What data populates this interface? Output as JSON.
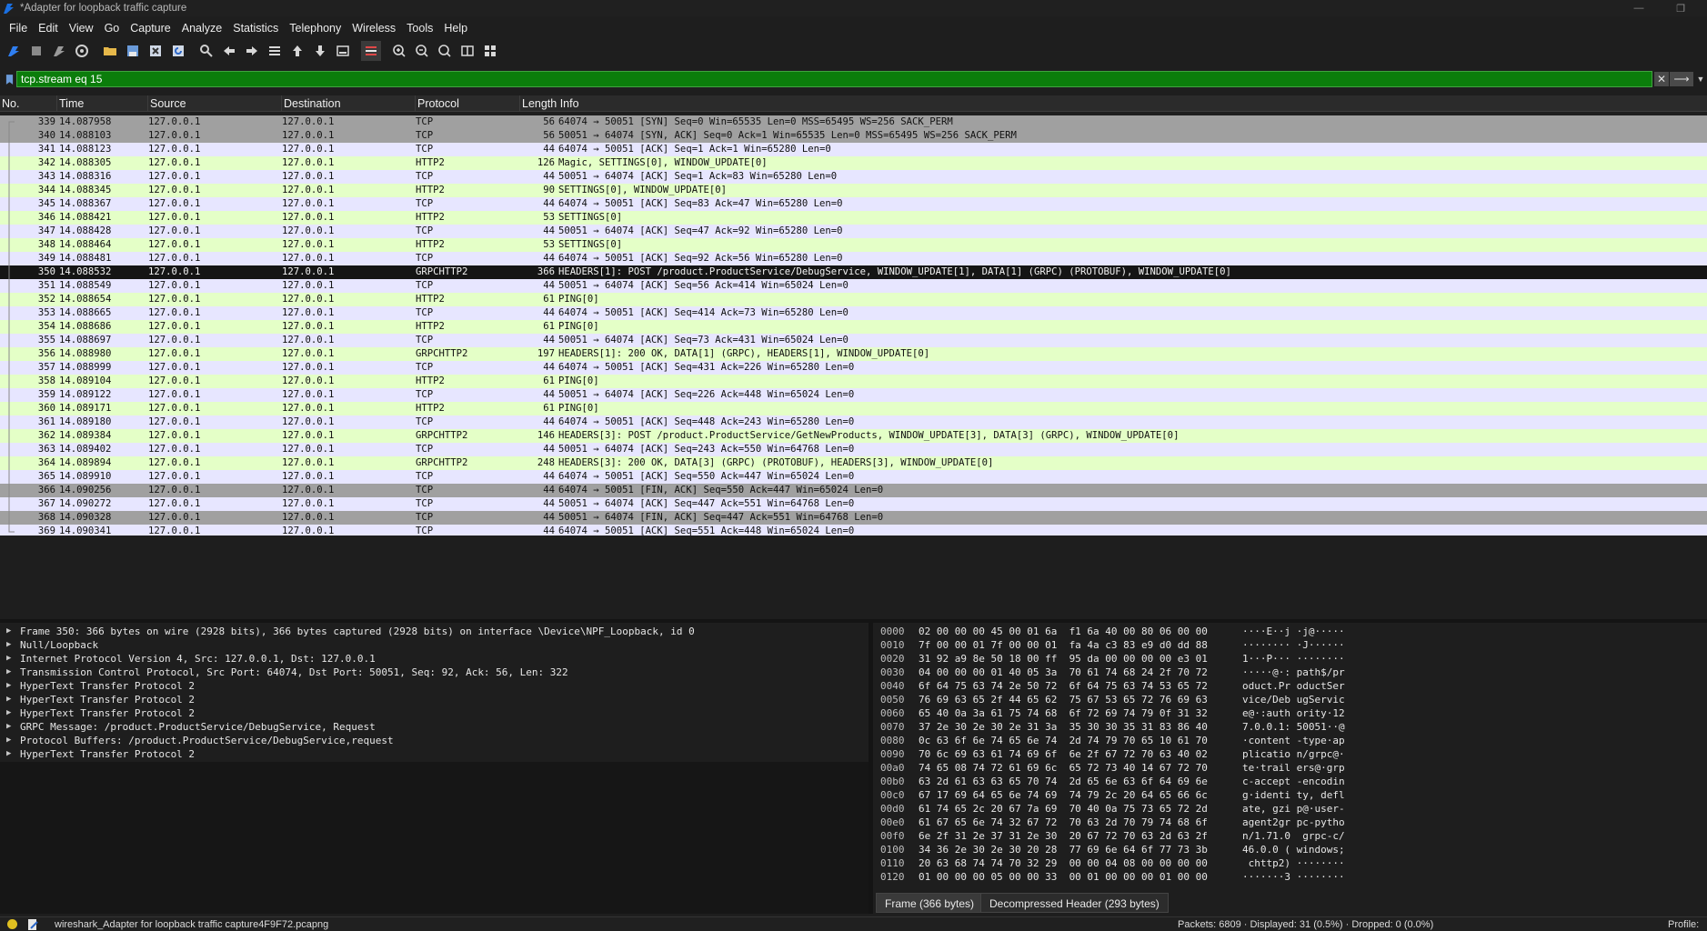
{
  "window": {
    "title": "*Adapter for loopback traffic capture",
    "minimize_glyph": "—",
    "maximize_glyph": "❐"
  },
  "menu": [
    "File",
    "Edit",
    "View",
    "Go",
    "Capture",
    "Analyze",
    "Statistics",
    "Telephony",
    "Wireless",
    "Tools",
    "Help"
  ],
  "toolbar_icons": [
    "shark-fin-start-icon",
    "stop-square-icon",
    "restart-fin-icon",
    "capture-options-icon",
    "open-folder-icon",
    "save-file-icon",
    "close-file-icon",
    "reload-icon",
    "find-packet-icon",
    "go-back-icon",
    "go-forward-icon",
    "go-to-packet-icon",
    "go-first-icon",
    "go-last-icon",
    "autoscroll-icon",
    "colorize-icon",
    "zoom-in-icon",
    "zoom-out-icon",
    "normal-size-icon",
    "resize-columns-icon",
    "expand-grid-icon"
  ],
  "filter": {
    "value": "tcp.stream eq 15",
    "clear_glyph": "✕",
    "apply_glyph": "⟶",
    "dropdown_glyph": "▼"
  },
  "columns": {
    "no": "No.",
    "time": "Time",
    "source": "Source",
    "destination": "Destination",
    "protocol": "Protocol",
    "length_info": "Length Info"
  },
  "packets": [
    {
      "no": "339",
      "time": "14.087958",
      "src": "127.0.0.1",
      "dst": "127.0.0.1",
      "proto": "TCP",
      "len": "56",
      "info": "64074 → 50051 [SYN] Seq=0 Win=65535 Len=0 MSS=65495 WS=256 SACK_PERM",
      "style": "fin"
    },
    {
      "no": "340",
      "time": "14.088103",
      "src": "127.0.0.1",
      "dst": "127.0.0.1",
      "proto": "TCP",
      "len": "56",
      "info": "50051 → 64074 [SYN, ACK] Seq=0 Ack=1 Win=65535 Len=0 MSS=65495 WS=256 SACK_PERM",
      "style": "fin"
    },
    {
      "no": "341",
      "time": "14.088123",
      "src": "127.0.0.1",
      "dst": "127.0.0.1",
      "proto": "TCP",
      "len": "44",
      "info": "64074 → 50051 [ACK] Seq=1 Ack=1 Win=65280 Len=0",
      "style": "tcp"
    },
    {
      "no": "342",
      "time": "14.088305",
      "src": "127.0.0.1",
      "dst": "127.0.0.1",
      "proto": "HTTP2",
      "len": "126",
      "info": "Magic, SETTINGS[0], WINDOW_UPDATE[0]",
      "style": "http2"
    },
    {
      "no": "343",
      "time": "14.088316",
      "src": "127.0.0.1",
      "dst": "127.0.0.1",
      "proto": "TCP",
      "len": "44",
      "info": "50051 → 64074 [ACK] Seq=1 Ack=83 Win=65280 Len=0",
      "style": "tcp"
    },
    {
      "no": "344",
      "time": "14.088345",
      "src": "127.0.0.1",
      "dst": "127.0.0.1",
      "proto": "HTTP2",
      "len": "90",
      "info": "SETTINGS[0], WINDOW_UPDATE[0]",
      "style": "http2"
    },
    {
      "no": "345",
      "time": "14.088367",
      "src": "127.0.0.1",
      "dst": "127.0.0.1",
      "proto": "TCP",
      "len": "44",
      "info": "64074 → 50051 [ACK] Seq=83 Ack=47 Win=65280 Len=0",
      "style": "tcp"
    },
    {
      "no": "346",
      "time": "14.088421",
      "src": "127.0.0.1",
      "dst": "127.0.0.1",
      "proto": "HTTP2",
      "len": "53",
      "info": "SETTINGS[0]",
      "style": "http2"
    },
    {
      "no": "347",
      "time": "14.088428",
      "src": "127.0.0.1",
      "dst": "127.0.0.1",
      "proto": "TCP",
      "len": "44",
      "info": "50051 → 64074 [ACK] Seq=47 Ack=92 Win=65280 Len=0",
      "style": "tcp"
    },
    {
      "no": "348",
      "time": "14.088464",
      "src": "127.0.0.1",
      "dst": "127.0.0.1",
      "proto": "HTTP2",
      "len": "53",
      "info": "SETTINGS[0]",
      "style": "http2"
    },
    {
      "no": "349",
      "time": "14.088481",
      "src": "127.0.0.1",
      "dst": "127.0.0.1",
      "proto": "TCP",
      "len": "44",
      "info": "64074 → 50051 [ACK] Seq=92 Ack=56 Win=65280 Len=0",
      "style": "tcp"
    },
    {
      "no": "350",
      "time": "14.088532",
      "src": "127.0.0.1",
      "dst": "127.0.0.1",
      "proto": "GRPCHTTP2",
      "len": "366",
      "info": "HEADERS[1]: POST /product.ProductService/DebugService, WINDOW_UPDATE[1], DATA[1] (GRPC) (PROTOBUF), WINDOW_UPDATE[0]",
      "style": "sel"
    },
    {
      "no": "351",
      "time": "14.088549",
      "src": "127.0.0.1",
      "dst": "127.0.0.1",
      "proto": "TCP",
      "len": "44",
      "info": "50051 → 64074 [ACK] Seq=56 Ack=414 Win=65024 Len=0",
      "style": "tcp"
    },
    {
      "no": "352",
      "time": "14.088654",
      "src": "127.0.0.1",
      "dst": "127.0.0.1",
      "proto": "HTTP2",
      "len": "61",
      "info": "PING[0]",
      "style": "http2"
    },
    {
      "no": "353",
      "time": "14.088665",
      "src": "127.0.0.1",
      "dst": "127.0.0.1",
      "proto": "TCP",
      "len": "44",
      "info": "64074 → 50051 [ACK] Seq=414 Ack=73 Win=65280 Len=0",
      "style": "tcp"
    },
    {
      "no": "354",
      "time": "14.088686",
      "src": "127.0.0.1",
      "dst": "127.0.0.1",
      "proto": "HTTP2",
      "len": "61",
      "info": "PING[0]",
      "style": "http2"
    },
    {
      "no": "355",
      "time": "14.088697",
      "src": "127.0.0.1",
      "dst": "127.0.0.1",
      "proto": "TCP",
      "len": "44",
      "info": "50051 → 64074 [ACK] Seq=73 Ack=431 Win=65024 Len=0",
      "style": "tcp"
    },
    {
      "no": "356",
      "time": "14.088980",
      "src": "127.0.0.1",
      "dst": "127.0.0.1",
      "proto": "GRPCHTTP2",
      "len": "197",
      "info": "HEADERS[1]: 200 OK, DATA[1] (GRPC), HEADERS[1], WINDOW_UPDATE[0]",
      "style": "http2"
    },
    {
      "no": "357",
      "time": "14.088999",
      "src": "127.0.0.1",
      "dst": "127.0.0.1",
      "proto": "TCP",
      "len": "44",
      "info": "64074 → 50051 [ACK] Seq=431 Ack=226 Win=65280 Len=0",
      "style": "tcp"
    },
    {
      "no": "358",
      "time": "14.089104",
      "src": "127.0.0.1",
      "dst": "127.0.0.1",
      "proto": "HTTP2",
      "len": "61",
      "info": "PING[0]",
      "style": "http2"
    },
    {
      "no": "359",
      "time": "14.089122",
      "src": "127.0.0.1",
      "dst": "127.0.0.1",
      "proto": "TCP",
      "len": "44",
      "info": "50051 → 64074 [ACK] Seq=226 Ack=448 Win=65024 Len=0",
      "style": "tcp"
    },
    {
      "no": "360",
      "time": "14.089171",
      "src": "127.0.0.1",
      "dst": "127.0.0.1",
      "proto": "HTTP2",
      "len": "61",
      "info": "PING[0]",
      "style": "http2"
    },
    {
      "no": "361",
      "time": "14.089180",
      "src": "127.0.0.1",
      "dst": "127.0.0.1",
      "proto": "TCP",
      "len": "44",
      "info": "64074 → 50051 [ACK] Seq=448 Ack=243 Win=65280 Len=0",
      "style": "tcp"
    },
    {
      "no": "362",
      "time": "14.089384",
      "src": "127.0.0.1",
      "dst": "127.0.0.1",
      "proto": "GRPCHTTP2",
      "len": "146",
      "info": "HEADERS[3]: POST /product.ProductService/GetNewProducts, WINDOW_UPDATE[3], DATA[3] (GRPC), WINDOW_UPDATE[0]",
      "style": "http2"
    },
    {
      "no": "363",
      "time": "14.089402",
      "src": "127.0.0.1",
      "dst": "127.0.0.1",
      "proto": "TCP",
      "len": "44",
      "info": "50051 → 64074 [ACK] Seq=243 Ack=550 Win=64768 Len=0",
      "style": "tcp"
    },
    {
      "no": "364",
      "time": "14.089894",
      "src": "127.0.0.1",
      "dst": "127.0.0.1",
      "proto": "GRPCHTTP2",
      "len": "248",
      "info": "HEADERS[3]: 200 OK, DATA[3] (GRPC) (PROTOBUF), HEADERS[3], WINDOW_UPDATE[0]",
      "style": "http2"
    },
    {
      "no": "365",
      "time": "14.089910",
      "src": "127.0.0.1",
      "dst": "127.0.0.1",
      "proto": "TCP",
      "len": "44",
      "info": "64074 → 50051 [ACK] Seq=550 Ack=447 Win=65024 Len=0",
      "style": "tcp"
    },
    {
      "no": "366",
      "time": "14.090256",
      "src": "127.0.0.1",
      "dst": "127.0.0.1",
      "proto": "TCP",
      "len": "44",
      "info": "64074 → 50051 [FIN, ACK] Seq=550 Ack=447 Win=65024 Len=0",
      "style": "fin"
    },
    {
      "no": "367",
      "time": "14.090272",
      "src": "127.0.0.1",
      "dst": "127.0.0.1",
      "proto": "TCP",
      "len": "44",
      "info": "50051 → 64074 [ACK] Seq=447 Ack=551 Win=64768 Len=0",
      "style": "tcp"
    },
    {
      "no": "368",
      "time": "14.090328",
      "src": "127.0.0.1",
      "dst": "127.0.0.1",
      "proto": "TCP",
      "len": "44",
      "info": "50051 → 64074 [FIN, ACK] Seq=447 Ack=551 Win=64768 Len=0",
      "style": "fin"
    },
    {
      "no": "369",
      "time": "14.090341",
      "src": "127.0.0.1",
      "dst": "127.0.0.1",
      "proto": "TCP",
      "len": "44",
      "info": "64074 → 50051 [ACK] Seq=551 Ack=448 Win=65024 Len=0",
      "style": "tcp"
    }
  ],
  "details": [
    "Frame 350: 366 bytes on wire (2928 bits), 366 bytes captured (2928 bits) on interface \\Device\\NPF_Loopback, id 0",
    "Null/Loopback",
    "Internet Protocol Version 4, Src: 127.0.0.1, Dst: 127.0.0.1",
    "Transmission Control Protocol, Src Port: 64074, Dst Port: 50051, Seq: 92, Ack: 56, Len: 322",
    "HyperText Transfer Protocol 2",
    "HyperText Transfer Protocol 2",
    "HyperText Transfer Protocol 2",
    "GRPC Message: /product.ProductService/DebugService, Request",
    "Protocol Buffers: /product.ProductService/DebugService,request",
    "HyperText Transfer Protocol 2"
  ],
  "hex": [
    {
      "off": "0000",
      "bytes": "02 00 00 00 45 00 01 6a  f1 6a 40 00 80 06 00 00",
      "ascii": "····E··j ·j@·····"
    },
    {
      "off": "0010",
      "bytes": "7f 00 00 01 7f 00 00 01  fa 4a c3 83 e9 d0 dd 88",
      "ascii": "········ ·J······"
    },
    {
      "off": "0020",
      "bytes": "31 92 a9 8e 50 18 00 ff  95 da 00 00 00 00 e3 01",
      "ascii": "1···P··· ········"
    },
    {
      "off": "0030",
      "bytes": "04 00 00 00 01 40 05 3a  70 61 74 68 24 2f 70 72",
      "ascii": "·····@·: path$/pr"
    },
    {
      "off": "0040",
      "bytes": "6f 64 75 63 74 2e 50 72  6f 64 75 63 74 53 65 72",
      "ascii": "oduct.Pr oductSer"
    },
    {
      "off": "0050",
      "bytes": "76 69 63 65 2f 44 65 62  75 67 53 65 72 76 69 63",
      "ascii": "vice/Deb ugServic"
    },
    {
      "off": "0060",
      "bytes": "65 40 0a 3a 61 75 74 68  6f 72 69 74 79 0f 31 32",
      "ascii": "e@·:auth ority·12"
    },
    {
      "off": "0070",
      "bytes": "37 2e 30 2e 30 2e 31 3a  35 30 30 35 31 83 86 40",
      "ascii": "7.0.0.1: 50051··@"
    },
    {
      "off": "0080",
      "bytes": "0c 63 6f 6e 74 65 6e 74  2d 74 79 70 65 10 61 70",
      "ascii": "·content -type·ap"
    },
    {
      "off": "0090",
      "bytes": "70 6c 69 63 61 74 69 6f  6e 2f 67 72 70 63 40 02",
      "ascii": "plicatio n/grpc@·"
    },
    {
      "off": "00a0",
      "bytes": "74 65 08 74 72 61 69 6c  65 72 73 40 14 67 72 70",
      "ascii": "te·trail ers@·grp"
    },
    {
      "off": "00b0",
      "bytes": "63 2d 61 63 63 65 70 74  2d 65 6e 63 6f 64 69 6e",
      "ascii": "c-accept -encodin"
    },
    {
      "off": "00c0",
      "bytes": "67 17 69 64 65 6e 74 69  74 79 2c 20 64 65 66 6c",
      "ascii": "g·identi ty, defl"
    },
    {
      "off": "00d0",
      "bytes": "61 74 65 2c 20 67 7a 69  70 40 0a 75 73 65 72 2d",
      "ascii": "ate, gzi p@·user-"
    },
    {
      "off": "00e0",
      "bytes": "61 67 65 6e 74 32 67 72  70 63 2d 70 79 74 68 6f",
      "ascii": "agent2gr pc-pytho"
    },
    {
      "off": "00f0",
      "bytes": "6e 2f 31 2e 37 31 2e 30  20 67 72 70 63 2d 63 2f",
      "ascii": "n/1.71.0  grpc-c/"
    },
    {
      "off": "0100",
      "bytes": "34 36 2e 30 2e 30 20 28  77 69 6e 64 6f 77 73 3b",
      "ascii": "46.0.0 ( windows;"
    },
    {
      "off": "0110",
      "bytes": "20 63 68 74 74 70 32 29  00 00 04 08 00 00 00 00",
      "ascii": " chttp2) ········"
    },
    {
      "off": "0120",
      "bytes": "01 00 00 00 05 00 00 33  00 01 00 00 00 01 00 00",
      "ascii": "·······3 ········"
    }
  ],
  "byte_tabs": {
    "frame": "Frame (366 bytes)",
    "decompressed": "Decompressed Header (293 bytes)"
  },
  "status": {
    "file": "wireshark_Adapter for loopback traffic capture4F9F72.pcapng",
    "packets": "Packets: 6809 · Displayed: 31 (0.5%) · Dropped: 0 (0.0%)",
    "profile": "Profile:"
  }
}
